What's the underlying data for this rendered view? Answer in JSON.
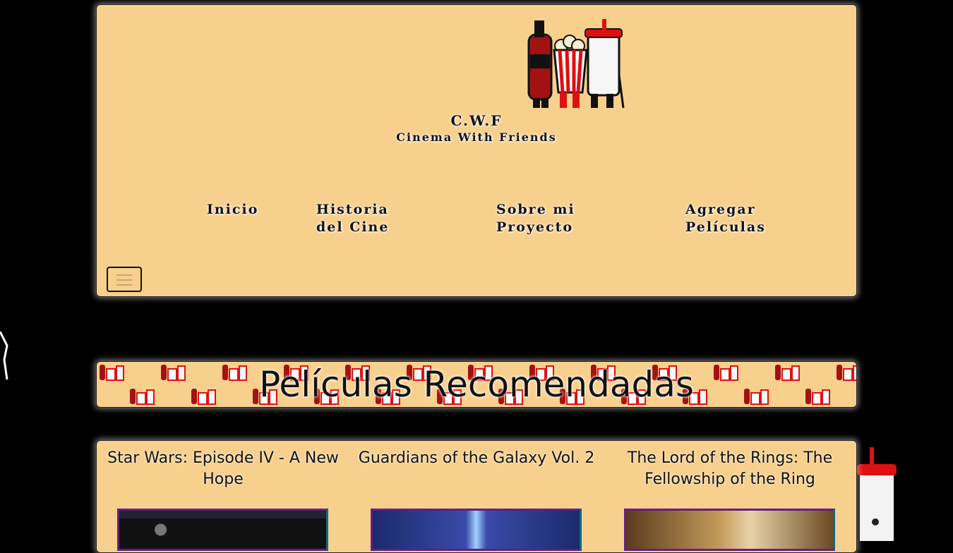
{
  "brand": {
    "short": "C.W.F",
    "long": "Cinema With Friends",
    "logo_icon": "cinema-snacks-logo-icon"
  },
  "nav": {
    "items": [
      {
        "label": "Inicio"
      },
      {
        "label": "Historia\ndel Cine"
      },
      {
        "label": "Sobre mi\nProyecto"
      },
      {
        "label": "Agregar\nPelículas"
      }
    ],
    "toggler_icon": "hamburger-menu-icon"
  },
  "banner": {
    "title": "Películas Recomendadas"
  },
  "movies": [
    {
      "title": "Star Wars: Episode IV - A New Hope",
      "poster_icon": "star-wars-poster"
    },
    {
      "title": "Guardians of the Galaxy Vol. 2",
      "poster_icon": "guardians-poster"
    },
    {
      "title": "The Lord of the Rings: The Fellowship of the Ring",
      "poster_icon": "lotr-poster"
    }
  ],
  "colors": {
    "panel": "#f8d08e",
    "background": "#000000",
    "poster_border": "#6a1b8a",
    "cola": "#a31212"
  }
}
